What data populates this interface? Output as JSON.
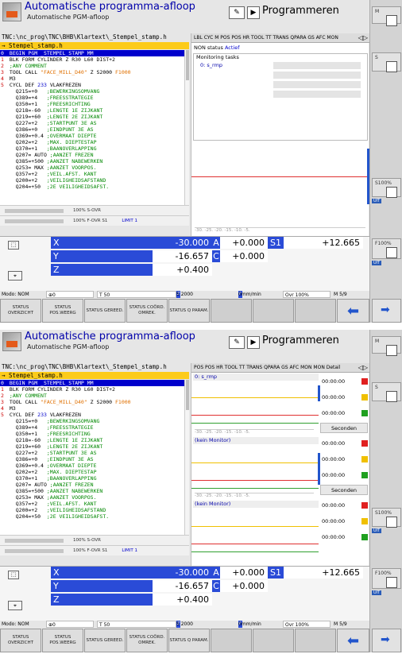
{
  "header": {
    "mode_title": "Automatische programma-afloop",
    "mode_subtitle": "Automatische PGM-afloop",
    "prog_title": "Programmeren"
  },
  "program": {
    "path": "TNC:\\nc_prog\\TNC\\BHB\\Klartext\\_Stempel_stamp.h",
    "file_s1": "→ Stempel_stamp.h",
    "file_s2": "→ Stempel_stamp.h",
    "lines": [
      {
        "n": "0",
        "t": "BEGIN PGM _STEMPEL_STAMP MM"
      },
      {
        "n": "1",
        "t": "BLK FORM CYLINDER Z R30 L60 DIST+2"
      },
      {
        "n": "2",
        "t": ";ANY COMMENT"
      },
      {
        "n": "3",
        "a": "TOOL CALL ",
        "b": "\"FACE_MILL_D40\"",
        "c": " Z S2000 ",
        "d": "F1000"
      },
      {
        "n": "4",
        "t": "M3"
      },
      {
        "n": "5",
        "a": "CYCL DEF ",
        "b2": "233",
        "c": " VLAKFREZEN"
      },
      {
        "n": "",
        "p": "   Q215=+0",
        "q": "   ;BEWERKINGSOMVANG"
      },
      {
        "n": "",
        "p": "   Q389=+4",
        "q": "   ;FREESSTRATEGIE"
      },
      {
        "n": "",
        "p": "   Q350=+1",
        "q": "   ;FREESRICHTING"
      },
      {
        "n": "",
        "p": "   Q218=-60",
        "q": "  ;LENGTE 1E ZIJKANT"
      },
      {
        "n": "",
        "p": "   Q219=+60",
        "q": "  ;LENGTE 2E ZIJKANT"
      },
      {
        "n": "",
        "p": "   Q227=+2",
        "q": "   ;STARTPUNT 3E AS"
      },
      {
        "n": "",
        "p": "   Q386=+0",
        "q": "   ;EINDPUNT 3E AS"
      },
      {
        "n": "",
        "p": "   Q369=+0.4",
        "q": " ;OVERMAAT DIEPTE"
      },
      {
        "n": "",
        "p": "   Q202=+2",
        "q": "   ;MAX. DIEPTESTAP"
      },
      {
        "n": "",
        "p": "   Q370=+1",
        "q": "   ;BAANOVERLAPPING"
      },
      {
        "n": "",
        "p": "   Q207= AUTO",
        "q": " ;AANZET FREZEN"
      },
      {
        "n": "",
        "p": "   Q385=+500",
        "q": " ;AANZET NABEWERKEN"
      },
      {
        "n": "",
        "p": "   Q253= MAX",
        "q": " ;AANZET VOORPOS."
      },
      {
        "n": "",
        "p": "   Q357=+2",
        "q": "   ;VEIL.AFST. KANT"
      },
      {
        "n": "",
        "p": "   Q200=+2",
        "q": "   ;VEILIGHEIDSAFSTAND"
      },
      {
        "n": "",
        "p": "   Q204=+50",
        "q": "  ;2E VEILIGHEIDSAFST."
      }
    ],
    "ovr_s": "100% S-OVR",
    "ovr_f": "100% F-OVR  S1",
    "limit": "LIMIT 1"
  },
  "panel1": {
    "tabs": "LBL CYC M POS POS HR TOOL TT TRANS QPARA GS AFC MON",
    "ns_label": "NON status",
    "ns_value": "Actief",
    "mon_title": "Monitoring tasks",
    "mon_row": "0: s_rmp",
    "scale": "-30.  -25.  -20.  -15.  -10.   -5."
  },
  "panel2": {
    "tabs": "POS POS HR TOOL TT TRANS QPARA GS AFC MON",
    "detail_tab": "MON Detail",
    "row1": "0: s_rmp",
    "kein1": "(kein Monitor)",
    "kein2": "(kein Monitor)",
    "seconden": "Seconden",
    "time": "00:00:00",
    "scale": "-30.  -25.  -20.  -15.  -10.   -5."
  },
  "axes": {
    "x_label": "X",
    "x_value": "-30.000",
    "a_label": "A",
    "a_value": "+0.000",
    "s1_label": "S1",
    "s1_value": "+12.665",
    "y_label": "Y",
    "y_value": "-16.657",
    "c_label": "C",
    "c_value": "+0.000",
    "z_label": "Z",
    "z_value": "+0.400"
  },
  "status": {
    "mode": "Modo: NOM",
    "t": "T 50",
    "s": "S 2000",
    "feed": "0mm/min",
    "ovr": "Ovr 100%",
    "m": "M 5/9"
  },
  "softkeys": [
    {
      "label": "STATUS OVERZICHT"
    },
    {
      "label": "STATUS POS.WEERG"
    },
    {
      "label": "STATUS GEREED."
    },
    {
      "label": "STATUS COÖRD. OMREK."
    },
    {
      "label": "STATUS Q PARAM."
    }
  ],
  "side": {
    "m": "M",
    "s": "S",
    "s100": "S100%",
    "f100": "F100%",
    "uit": "UIT",
    "aa": "AA"
  }
}
